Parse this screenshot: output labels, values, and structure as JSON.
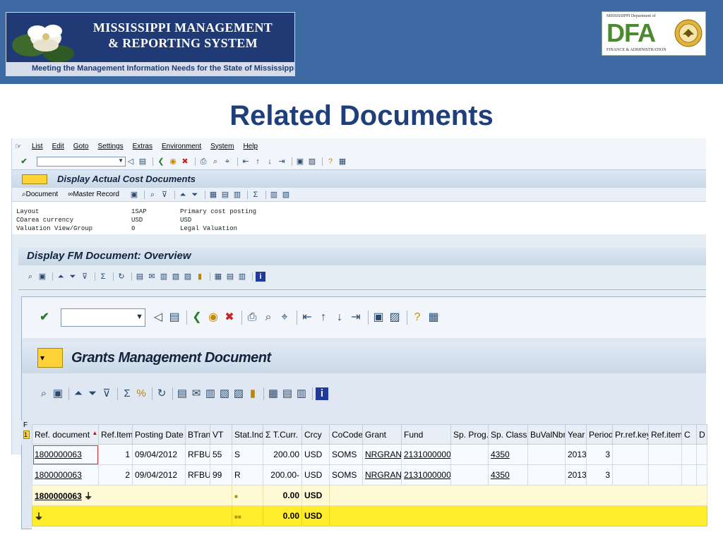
{
  "banner": {
    "mmrs_line1": "MISSISSIPPI MANAGEMENT",
    "mmrs_line2": "& REPORTING SYSTEM",
    "mmrs_tagline": "Meeting the Management Information Needs for the State of Mississippi",
    "dfa_top": "MISSISSIPPI Department of",
    "dfa_letters": "DFA",
    "dfa_bottom": "FINANCE & ADMINISTRATION"
  },
  "slide_title": "Related Documents",
  "menu": [
    "List",
    "Edit",
    "Goto",
    "Settings",
    "Extras",
    "Environment",
    "System",
    "Help"
  ],
  "screen1": {
    "title": "Display Actual Cost Documents",
    "app_toolbar": {
      "document": "Document",
      "master_record": "Master Record"
    },
    "header": [
      {
        "label": "Layout",
        "value": "1SAP",
        "desc": "Primary cost posting"
      },
      {
        "label": "COarea currency",
        "value": "USD",
        "desc": "USD"
      },
      {
        "label": "Valuation View/Group",
        "value": "0",
        "desc": "Legal Valuation"
      }
    ]
  },
  "screen2": {
    "title": "Display FM Document: Overview"
  },
  "screen3": {
    "title": "Grants Management Document",
    "left_strip": {
      "top": "F",
      "bottom": "1"
    },
    "columns": [
      "Ref. document",
      "Ref.Item",
      "Posting Date",
      "BTran",
      "VT",
      "Stat.Ind.",
      "Σ T.Curr.",
      "Crcy",
      "CoCode",
      "Grant",
      "Fund",
      "Sp. Prog.",
      "Sp. Class",
      "BuValNbr.",
      "Year",
      "Period",
      "Pr.ref.key",
      "Ref.item",
      "C",
      "D"
    ],
    "rows": [
      {
        "ref_doc": "1800000063",
        "ref_item": "1",
        "posting_date": "09/04/2012",
        "btran": "RFBU",
        "vt": "55",
        "stat_ind": "S",
        "amount": "200.00",
        "crcy": "USD",
        "cocode": "SOMS",
        "grant": "NRGRANT",
        "fund": "2131000000",
        "sp_prog": "",
        "sp_class": "4350",
        "buvalnbr": "",
        "year": "2013",
        "period": "3"
      },
      {
        "ref_doc": "1800000063",
        "ref_item": "2",
        "posting_date": "09/04/2012",
        "btran": "RFBU",
        "vt": "99",
        "stat_ind": "R",
        "amount": "200.00-",
        "crcy": "USD",
        "cocode": "SOMS",
        "grant": "NRGRANT",
        "fund": "2131000000",
        "sp_prog": "",
        "sp_class": "4350",
        "buvalnbr": "",
        "year": "2013",
        "period": "3"
      }
    ],
    "subtotal": {
      "ref_doc": "1800000063",
      "amount": "0.00",
      "crcy": "USD"
    },
    "total": {
      "amount": "0.00",
      "crcy": "USD"
    }
  },
  "icons": {
    "enter": "check-icon",
    "back": "back-icon",
    "save": "save-icon",
    "print": "print-icon",
    "find": "find-icon",
    "help": "help-icon",
    "info": "info-icon",
    "subtotal_marker": "subtotal-icon"
  }
}
